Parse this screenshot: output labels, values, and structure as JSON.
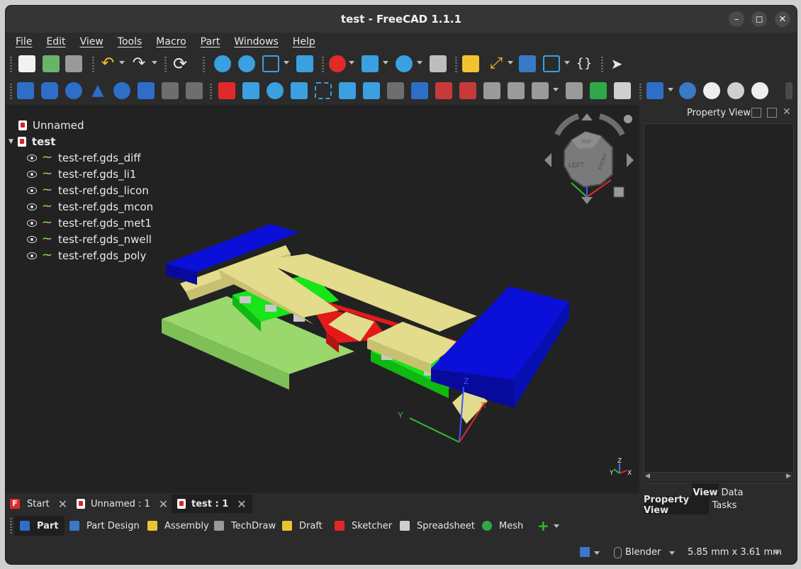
{
  "window": {
    "title": "test - FreeCAD 1.1.1"
  },
  "menu": [
    "File",
    "Edit",
    "View",
    "Tools",
    "Macro",
    "Part",
    "Windows",
    "Help"
  ],
  "tree": {
    "root_doc": "Unnamed",
    "active_doc": "test",
    "items": [
      "test-ref.gds_diff",
      "test-ref.gds_li1",
      "test-ref.gds_licon",
      "test-ref.gds_mcon",
      "test-ref.gds_met1",
      "test-ref.gds_nwell",
      "test-ref.gds_poly"
    ]
  },
  "navcube": {
    "top": "TOP",
    "left": "LEFT",
    "front": "FRONT"
  },
  "axes": {
    "x": "X",
    "y": "Y",
    "z": "Z"
  },
  "property_view": {
    "title": "Property View",
    "tabs": [
      "View",
      "Data"
    ],
    "bottom_tabs": [
      "Property View",
      "Tasks"
    ]
  },
  "doc_tabs": [
    "Start",
    "Unnamed : 1",
    "test : 1"
  ],
  "workbenches": [
    "Part",
    "Part Design",
    "Assembly",
    "TechDraw",
    "Draft",
    "Sketcher",
    "Spreadsheet",
    "Mesh"
  ],
  "status": {
    "nav_style": "Blender",
    "dimensions": "5.85 mm x 3.61 mm"
  },
  "colors": {
    "met1": "#0a10d8",
    "li1": "#e3dc8c",
    "diff": "#18e41a",
    "nwell": "#9ad86e",
    "poly": "#e21a1a",
    "licon": "#c8c8c8"
  }
}
